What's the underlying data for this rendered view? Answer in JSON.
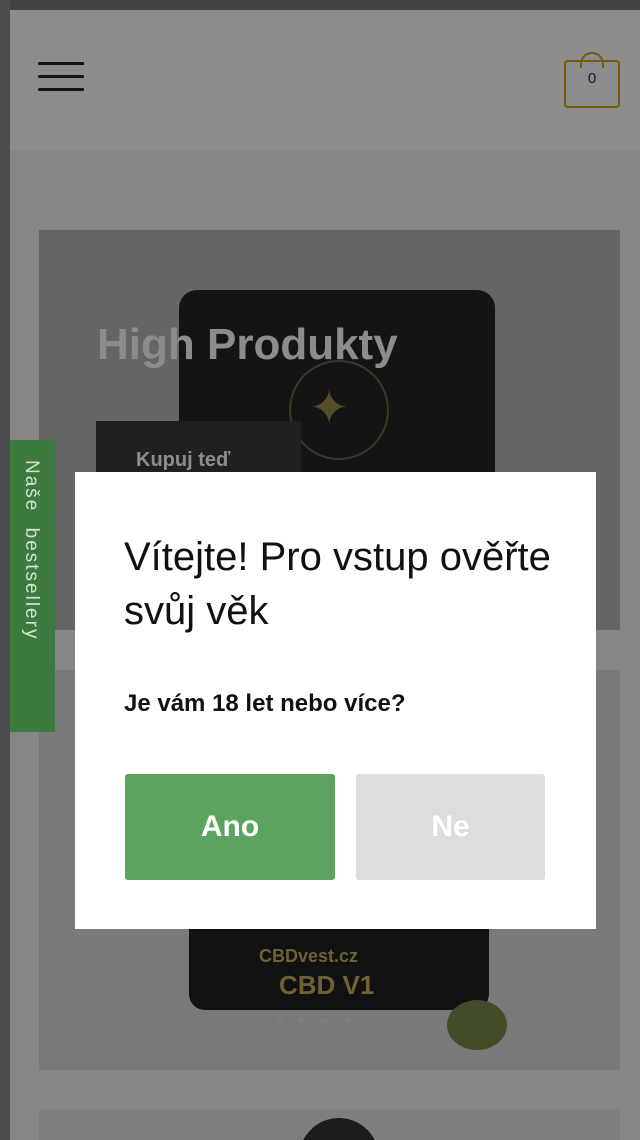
{
  "header": {
    "menu_icon": "hamburger-menu-icon",
    "cart_icon": "shopping-bag-icon",
    "cart_count": "0"
  },
  "hero": {
    "title": "High Produkty",
    "button_label": "Kupuj teď"
  },
  "product_tile": {
    "brand": "CBDvest.cz",
    "name": "CBD V1"
  },
  "side_tab": {
    "label": "Naše bestsellery"
  },
  "age_modal": {
    "title": "Vítejte! Pro vstup ověřte svůj věk",
    "question": "Je vám 18 let nebo více?",
    "yes_label": "Ano",
    "no_label": "Ne"
  },
  "colors": {
    "accent_gold": "#d6a418",
    "yes_green": "#5ca35e",
    "side_tab_green": "#3c7a3e",
    "no_grey": "#dddddd"
  }
}
